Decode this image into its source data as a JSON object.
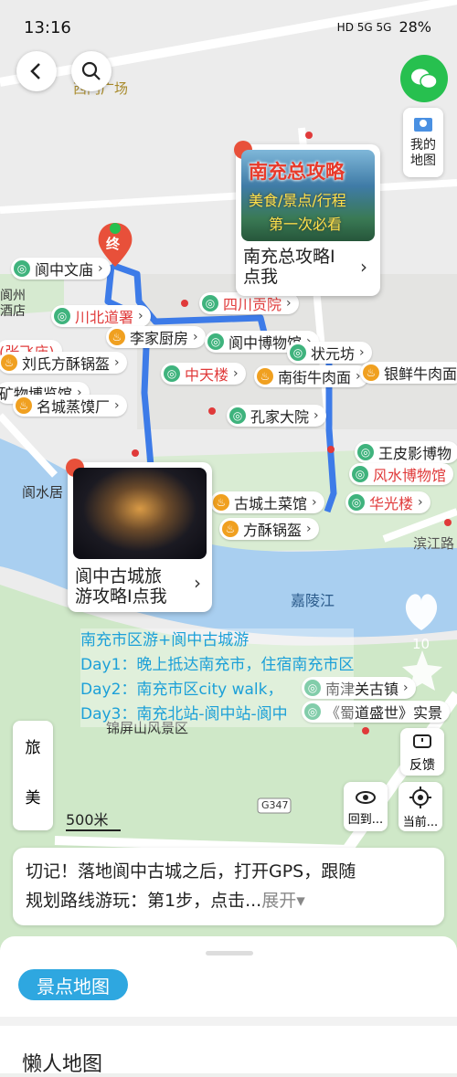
{
  "status_bar": {
    "time": "13:16",
    "battery": "28%",
    "signal": "HD 5G 5G"
  },
  "header": {
    "back_icon": "back-arrow-icon",
    "search_icon": "search-icon",
    "wechat_icon": "wechat-icon"
  },
  "my_map": {
    "label_1": "我的",
    "label_2": "地图"
  },
  "map_labels": {
    "west_square": "西门广场",
    "langzhou_hotel_1": "阆州",
    "langzhou_hotel_2": "酒店",
    "langshui_ju": "阆水居",
    "jialing_river": "嘉陵江",
    "jinping_shan": "锦屏山风景区",
    "binjiang_road": "滨江路",
    "road_g347": "G347",
    "destination": "终"
  },
  "pois": [
    {
      "name": "阆中文庙",
      "type": "scenic",
      "red": false
    },
    {
      "name": "川北道署",
      "type": "scenic",
      "red": true
    },
    {
      "name": "四川贡院",
      "type": "scenic",
      "red": true
    },
    {
      "name": "李家厨房",
      "type": "food",
      "red": false
    },
    {
      "name": "阆中博物馆",
      "type": "scenic",
      "red": false
    },
    {
      "name": "状元坊",
      "type": "scenic",
      "red": false
    },
    {
      "name": "(张飞庙)",
      "type": "scenic",
      "red": true
    },
    {
      "name": "刘氏方酥锅盔",
      "type": "food",
      "red": false
    },
    {
      "name": "中天楼",
      "type": "scenic",
      "red": true
    },
    {
      "name": "南街牛肉面",
      "type": "food",
      "red": false
    },
    {
      "name": "银鲜牛肉面",
      "type": "food",
      "red": false
    },
    {
      "name": "矿物博览馆",
      "type": "scenic",
      "red": false
    },
    {
      "name": "名城蒸馍厂",
      "type": "food",
      "red": false
    },
    {
      "name": "孔家大院",
      "type": "scenic",
      "red": false
    },
    {
      "name": "王皮影博物",
      "type": "scenic",
      "red": false
    },
    {
      "name": "风水博物馆",
      "type": "scenic",
      "red": true
    },
    {
      "name": "古城土菜馆",
      "type": "food",
      "red": false
    },
    {
      "name": "华光楼",
      "type": "scenic",
      "red": true
    },
    {
      "name": "方酥锅盔",
      "type": "food",
      "red": false
    },
    {
      "name": "南津关古镇",
      "type": "scenic",
      "red": false
    },
    {
      "name": "《蜀道盛世》实景",
      "type": "scenic",
      "red": false
    }
  ],
  "cards": [
    {
      "image_line_1": "南充总攻略",
      "image_line_2": "美食/景点/行程",
      "image_line_3": "第一次必看",
      "text_1": "南充总攻略I",
      "text_2": "点我"
    },
    {
      "text_1": "阆中古城旅",
      "text_2": "游攻略I点我"
    }
  ],
  "routes": [
    "南充市区游+阆中古城游",
    "Day1：晚上抵达南充市，住宿南充市区",
    "Day2：南充市区city walk，",
    "Day3：南充北站-阆中站-阆中"
  ],
  "side_tabs": [
    "旅",
    "美"
  ],
  "like_count": "10",
  "feedback": {
    "label": "反馈"
  },
  "view_button": {
    "label": "回到..."
  },
  "locate_button": {
    "label": "当前..."
  },
  "scale": "500米",
  "notice": {
    "line_1": "切记！落地阆中古城之后，打开GPS，跟随",
    "line_2": "规划路线游玩：第1步，点击...",
    "more": "展开"
  },
  "sheet": {
    "pill": "景点地图",
    "section_title": "懒人地图"
  },
  "colors": {
    "route": "#3d7be8",
    "river": "#a9cff0",
    "green": "#cfe8c8",
    "accent": "#2ea7e0",
    "wechat": "#27c04f"
  }
}
